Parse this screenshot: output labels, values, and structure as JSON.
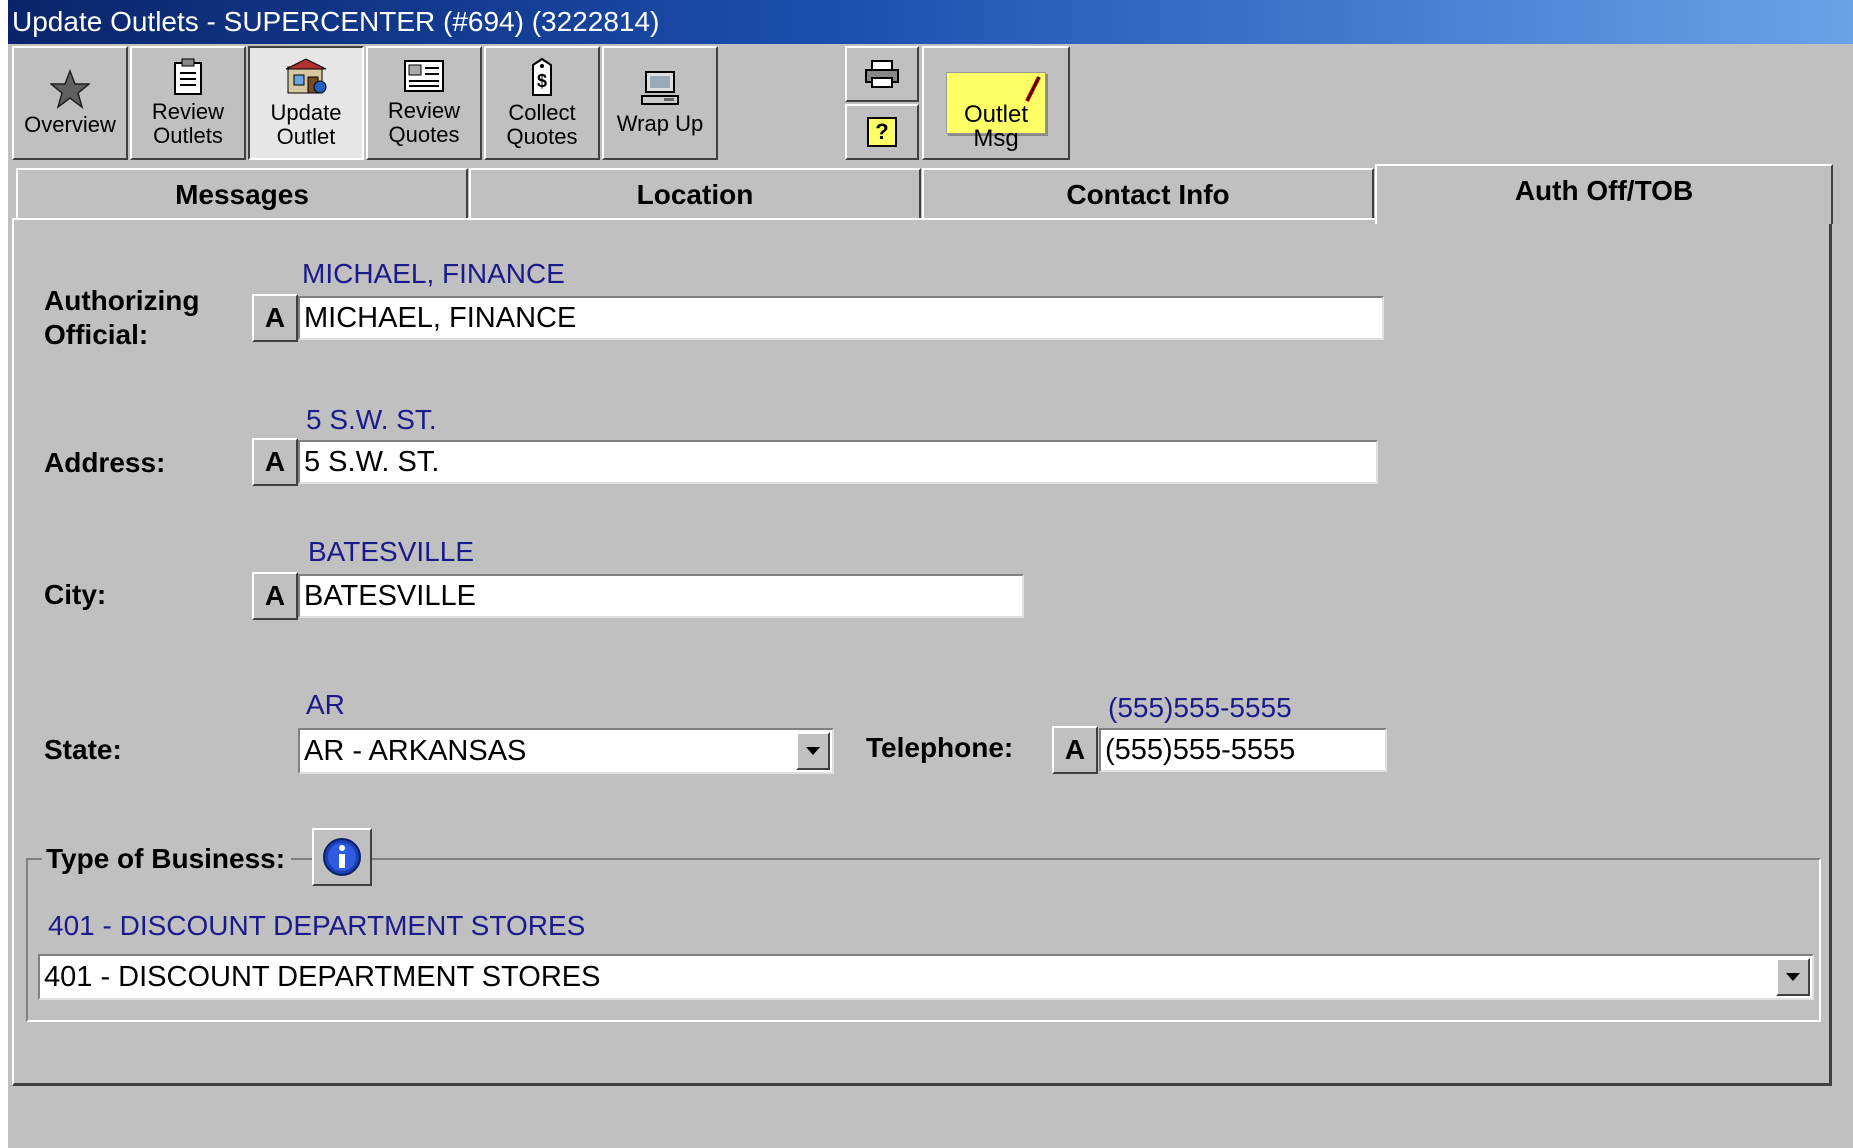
{
  "window": {
    "title": "Update Outlets - SUPERCENTER (#694) (3222814)"
  },
  "toolbar": {
    "overview": "Overview",
    "review_outlets": "Review\nOutlets",
    "update_outlet": "Update\nOutlet",
    "review_quotes": "Review\nQuotes",
    "collect_quotes": "Collect\nQuotes",
    "wrap_up": "Wrap Up",
    "help_glyph": "?",
    "outlet_msg": "Outlet\nMsg"
  },
  "tabs": [
    {
      "label": "Messages",
      "selected": false
    },
    {
      "label": "Location",
      "selected": false
    },
    {
      "label": "Contact Info",
      "selected": false
    },
    {
      "label": "Auth Off/TOB",
      "selected": true
    }
  ],
  "form": {
    "accept_button": "A",
    "authorizing_official": {
      "label": "Authorizing\nOfficial:",
      "original": "MICHAEL, FINANCE",
      "value": "MICHAEL, FINANCE"
    },
    "address": {
      "label": "Address:",
      "original": "5  S.W.  ST.",
      "value": "5  S.W.  ST."
    },
    "city": {
      "label": "City:",
      "original": "BATESVILLE",
      "value": "BATESVILLE"
    },
    "state": {
      "label": "State:",
      "original": "AR",
      "value": "AR - ARKANSAS"
    },
    "telephone": {
      "label": "Telephone:",
      "original": "(555)555-5555",
      "value": "(555)555-5555"
    },
    "type_of_business": {
      "label": "Type of Business:",
      "original": "401 - DISCOUNT DEPARTMENT STORES",
      "value": "401 - DISCOUNT DEPARTMENT STORES"
    }
  },
  "colors": {
    "title_bar": "#0a246a",
    "original_value_text": "#1a1a8c",
    "sticky_note": "#ffff66",
    "face": "#c0c0c0"
  }
}
